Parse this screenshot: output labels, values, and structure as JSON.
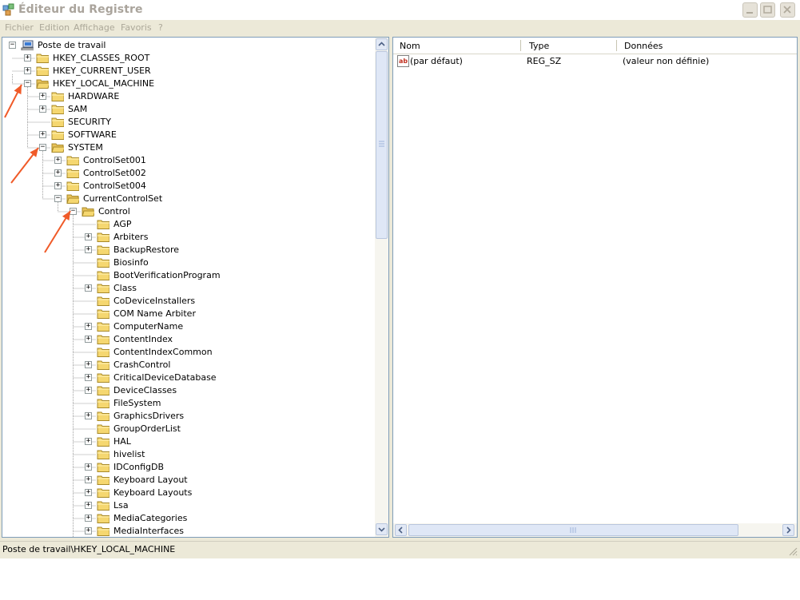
{
  "title": "Éditeur du Registre",
  "menu": [
    "Fichier",
    "Edition",
    "Affichage",
    "Favoris",
    "?"
  ],
  "tree": [
    {
      "label": "Poste de travail",
      "expander": "−",
      "icon": "computer-icon"
    },
    {
      "label": "HKEY_CLASSES_ROOT",
      "expander": "+",
      "icon": "folder-icon"
    },
    {
      "label": "HKEY_CURRENT_USER",
      "expander": "+",
      "icon": "folder-icon"
    },
    {
      "label": "HKEY_LOCAL_MACHINE",
      "expander": "−",
      "icon": "folder-open-icon"
    },
    {
      "label": "HARDWARE",
      "expander": "+",
      "icon": "folder-icon"
    },
    {
      "label": "SAM",
      "expander": "+",
      "icon": "folder-icon"
    },
    {
      "label": "SECURITY",
      "expander": "",
      "icon": "folder-icon"
    },
    {
      "label": "SOFTWARE",
      "expander": "+",
      "icon": "folder-icon"
    },
    {
      "label": "SYSTEM",
      "expander": "−",
      "icon": "folder-open-icon"
    },
    {
      "label": "ControlSet001",
      "expander": "+",
      "icon": "folder-icon"
    },
    {
      "label": "ControlSet002",
      "expander": "+",
      "icon": "folder-icon"
    },
    {
      "label": "ControlSet004",
      "expander": "+",
      "icon": "folder-icon"
    },
    {
      "label": "CurrentControlSet",
      "expander": "−",
      "icon": "folder-open-icon"
    },
    {
      "label": "Control",
      "expander": "−",
      "icon": "folder-open-icon"
    },
    {
      "label": "AGP",
      "expander": "",
      "icon": "folder-icon"
    },
    {
      "label": "Arbiters",
      "expander": "+",
      "icon": "folder-icon"
    },
    {
      "label": "BackupRestore",
      "expander": "+",
      "icon": "folder-icon"
    },
    {
      "label": "Biosinfo",
      "expander": "",
      "icon": "folder-icon"
    },
    {
      "label": "BootVerificationProgram",
      "expander": "",
      "icon": "folder-icon"
    },
    {
      "label": "Class",
      "expander": "+",
      "icon": "folder-icon"
    },
    {
      "label": "CoDeviceInstallers",
      "expander": "",
      "icon": "folder-icon"
    },
    {
      "label": "COM Name Arbiter",
      "expander": "",
      "icon": "folder-icon"
    },
    {
      "label": "ComputerName",
      "expander": "+",
      "icon": "folder-icon"
    },
    {
      "label": "ContentIndex",
      "expander": "+",
      "icon": "folder-icon"
    },
    {
      "label": "ContentIndexCommon",
      "expander": "",
      "icon": "folder-icon"
    },
    {
      "label": "CrashControl",
      "expander": "+",
      "icon": "folder-icon"
    },
    {
      "label": "CriticalDeviceDatabase",
      "expander": "+",
      "icon": "folder-icon"
    },
    {
      "label": "DeviceClasses",
      "expander": "+",
      "icon": "folder-icon"
    },
    {
      "label": "FileSystem",
      "expander": "",
      "icon": "folder-icon"
    },
    {
      "label": "GraphicsDrivers",
      "expander": "+",
      "icon": "folder-icon"
    },
    {
      "label": "GroupOrderList",
      "expander": "",
      "icon": "folder-icon"
    },
    {
      "label": "HAL",
      "expander": "+",
      "icon": "folder-icon"
    },
    {
      "label": "hivelist",
      "expander": "",
      "icon": "folder-icon"
    },
    {
      "label": "IDConfigDB",
      "expander": "+",
      "icon": "folder-icon"
    },
    {
      "label": "Keyboard Layout",
      "expander": "+",
      "icon": "folder-icon"
    },
    {
      "label": "Keyboard Layouts",
      "expander": "+",
      "icon": "folder-icon"
    },
    {
      "label": "Lsa",
      "expander": "+",
      "icon": "folder-icon"
    },
    {
      "label": "MediaCategories",
      "expander": "+",
      "icon": "folder-icon"
    },
    {
      "label": "MediaInterfaces",
      "expander": "+",
      "icon": "folder-icon"
    }
  ],
  "columns": {
    "name": "Nom",
    "type": "Type",
    "data": "Données"
  },
  "values": [
    {
      "name": "(par défaut)",
      "type": "REG_SZ",
      "data": "(valeur non définie)",
      "icon": "string-value-icon"
    }
  ],
  "status": "Poste de travail\\HKEY_LOCAL_MACHINE",
  "colors": {
    "annotation_arrow": "#f05a28",
    "pane_border": "#7f9db9",
    "folder": "#f5d770"
  }
}
